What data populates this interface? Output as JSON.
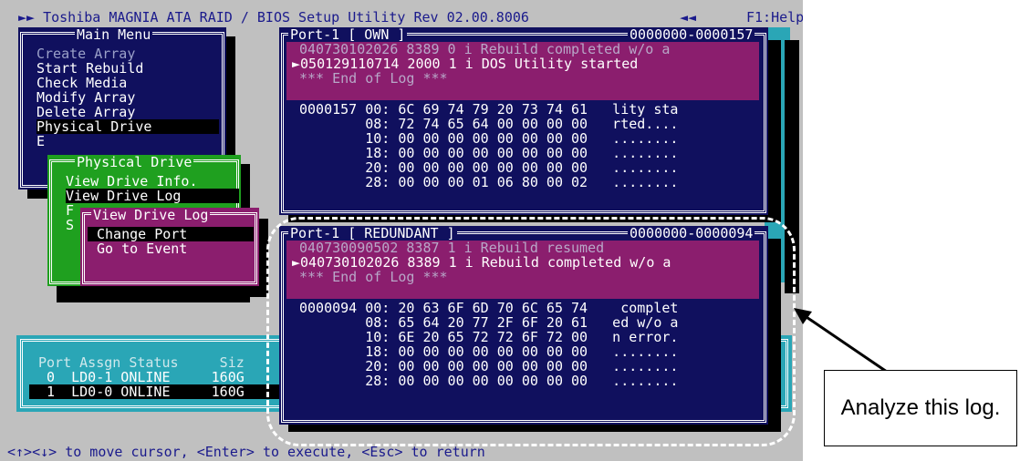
{
  "header": {
    "title": "►► Toshiba MAGNIA ATA RAID / BIOS Setup Utility Rev 02.00.8006",
    "nav_glyph": "◄◄",
    "help": "F1:Help"
  },
  "main_menu": {
    "title": "Main Menu",
    "items": [
      "Create Array",
      "Start Rebuild",
      "Check Media",
      "Modify Array",
      "Delete Array",
      "Physical Drive",
      "E"
    ]
  },
  "physical_drive_menu": {
    "title": "Physical Drive",
    "items": [
      "View Drive Info.",
      "View Drive Log",
      "F",
      "S"
    ]
  },
  "view_drive_log_menu": {
    "title": "View Drive Log",
    "items": [
      "Change Port",
      "Go to Event"
    ]
  },
  "port_table": {
    "headers": "Port Assgn Status     Siz",
    "rows": [
      " 0  LD0-1 ONLINE     160G",
      " 1  LD0-0 ONLINE     160G"
    ]
  },
  "log_own": {
    "title": "Port-1 [ OWN ]",
    "range": "0000000-0000157",
    "entries": [
      "040730102026 8389 0 i Rebuild completed w/o a",
      "►050129110714 2000 1 i DOS Utility started",
      "*** End of Log ***"
    ],
    "hex": [
      "0000157 00: 6C 69 74 79 20 73 74 61   lity sta",
      "        08: 72 74 65 64 00 00 00 00   rted....",
      "        10: 00 00 00 00 00 00 00 00   ........",
      "        18: 00 00 00 00 00 00 00 00   ........",
      "        20: 00 00 00 00 00 00 00 00   ........",
      "        28: 00 00 00 01 06 80 00 02   ........"
    ]
  },
  "log_redundant": {
    "title": "Port-1 [ REDUNDANT ]",
    "range": "0000000-0000094",
    "entries": [
      "040730090502 8387 1 i Rebuild resumed",
      "►040730102026 8389 1 i Rebuild completed w/o a",
      "*** End of Log ***"
    ],
    "hex": [
      "0000094 00: 20 63 6F 6D 70 6C 65 74    complet",
      "        08: 65 64 20 77 2F 6F 20 61   ed w/o a",
      "        10: 6E 20 65 72 72 6F 72 00   n error.",
      "        18: 00 00 00 00 00 00 00 00   ........",
      "        20: 00 00 00 00 00 00 00 00   ........",
      "        28: 00 00 00 00 00 00 00 00   ........"
    ]
  },
  "status_bar": "<↑><↓> to move cursor, <Enter> to execute, <Esc> to return",
  "callout": "Analyze this log.",
  "colors": {
    "screen_bg": "#c0c0c0",
    "navy": "#10105e",
    "green": "#1fa01f",
    "magenta": "#8b1e6e",
    "cyan": "#2aa6b6"
  }
}
